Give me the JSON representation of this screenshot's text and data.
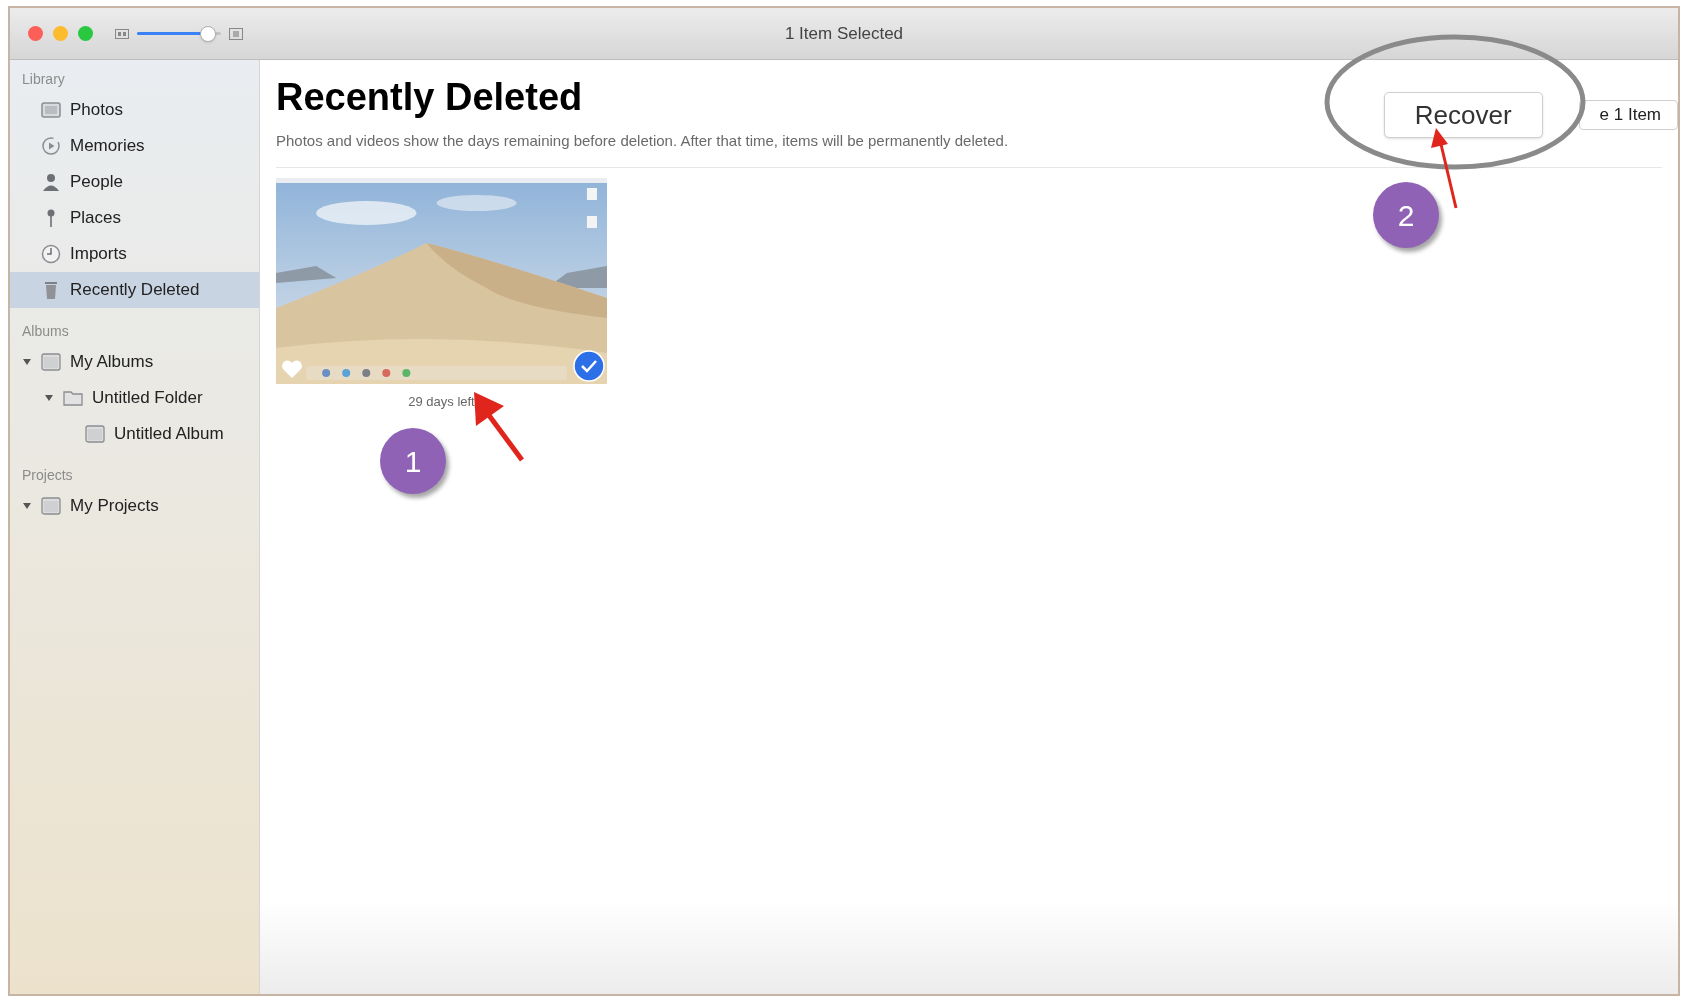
{
  "window": {
    "title": "1 Item Selected"
  },
  "toolbar": {
    "zoom_slider": {
      "level": 0.85
    }
  },
  "sidebar": {
    "sections": [
      {
        "heading": "Library",
        "items": [
          {
            "label": "Photos",
            "kind": "photos",
            "selected": false
          },
          {
            "label": "Memories",
            "kind": "memories",
            "selected": false
          },
          {
            "label": "People",
            "kind": "people",
            "selected": false
          },
          {
            "label": "Places",
            "kind": "places",
            "selected": false
          },
          {
            "label": "Imports",
            "kind": "imports",
            "selected": false
          },
          {
            "label": "Recently Deleted",
            "kind": "trash",
            "selected": true
          }
        ]
      },
      {
        "heading": "Albums",
        "items": [
          {
            "label": "My Albums",
            "kind": "album",
            "selected": false,
            "expanded": true,
            "children": [
              {
                "label": "Untitled Folder",
                "kind": "folder",
                "selected": false,
                "expanded": true,
                "children": [
                  {
                    "label": "Untitled Album",
                    "kind": "album",
                    "selected": false
                  }
                ]
              }
            ]
          }
        ]
      },
      {
        "heading": "Projects",
        "items": [
          {
            "label": "My Projects",
            "kind": "album",
            "selected": false,
            "expanded": true
          }
        ]
      }
    ]
  },
  "main": {
    "title": "Recently Deleted",
    "subtitle": "Photos and videos show the days remaining before deletion. After that time, items will be permanently deleted.",
    "buttons": [
      {
        "label": "Recover"
      },
      {
        "label": "e 1 Item"
      }
    ],
    "photos": [
      {
        "kind": "picture",
        "caption": "29 days left",
        "selected": true,
        "favorite": true
      }
    ]
  },
  "annotations": [
    {
      "number": "1"
    },
    {
      "number": "2"
    }
  ]
}
